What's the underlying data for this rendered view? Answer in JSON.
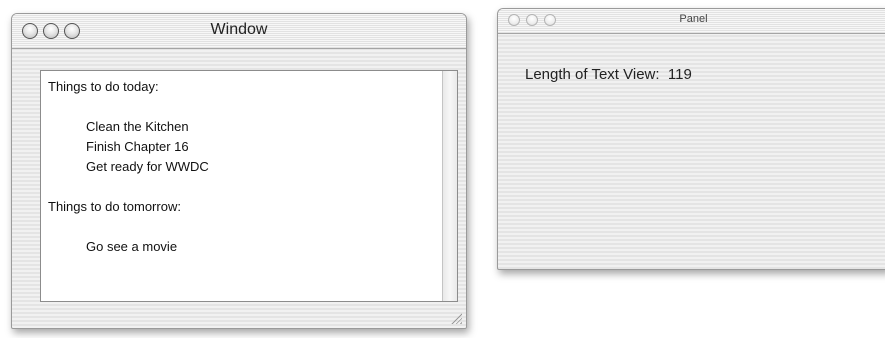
{
  "window": {
    "title": "Window",
    "text_view": {
      "lines": [
        {
          "text": "Things to do today:",
          "indent": false
        },
        {
          "text": "",
          "indent": false
        },
        {
          "text": "Clean the Kitchen",
          "indent": true
        },
        {
          "text": "Finish Chapter 16",
          "indent": true
        },
        {
          "text": "Get ready for WWDC",
          "indent": true
        },
        {
          "text": "",
          "indent": false
        },
        {
          "text": "Things to do tomorrow:",
          "indent": false
        },
        {
          "text": "",
          "indent": false
        },
        {
          "text": "Go see a movie",
          "indent": true
        }
      ]
    }
  },
  "panel": {
    "title": "Panel",
    "label": "Length of Text View:  119"
  },
  "icons": {
    "close": "close-button-icon",
    "minimize": "minimize-button-icon",
    "zoom": "zoom-button-icon",
    "resize": "resize-grip-icon"
  }
}
